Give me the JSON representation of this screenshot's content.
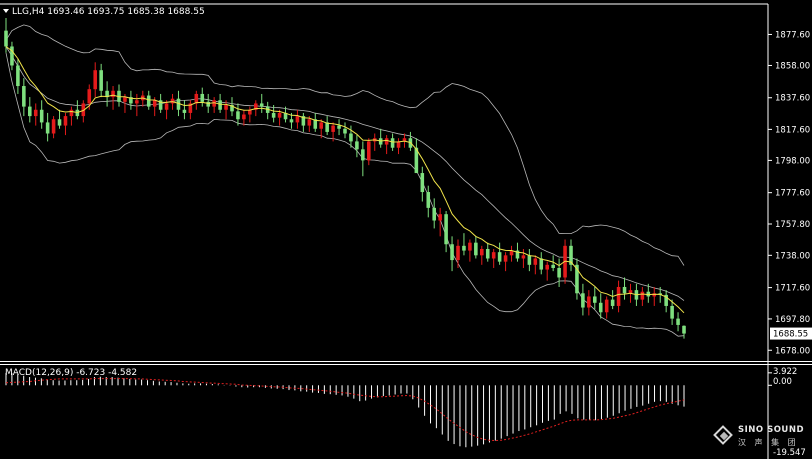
{
  "header": {
    "symbol_line": "LLG,H4  1693.46 1693.75 1685.38 1688.55",
    "menu_icon": "triangle-down-icon"
  },
  "macd": {
    "label": "MACD(12,26,9) -6.723 -4.582",
    "tick_top": "3.922",
    "tick_zero": "0.00",
    "tick_bottom": "-19.547"
  },
  "logo": {
    "name": "SINO SOUND",
    "sub": "汉 声 集 团",
    "icon": "diamond-logo-icon"
  },
  "colors": {
    "background": "#000000",
    "bull": "#e41b1b",
    "bear": "#7fe07f",
    "bands": "#b8b8b8",
    "ma": "#f0e34a",
    "macd_hist": "#ffffff",
    "macd_signal": "#e02020",
    "price_label_bg": "#ffffff",
    "price_label_fg": "#000000"
  },
  "chart_data": {
    "type": "candlestick",
    "ylim": [
      1675.0,
      1888.0
    ],
    "yticks": [
      "1877.60",
      "1858.00",
      "1837.60",
      "1817.60",
      "1798.00",
      "1777.60",
      "1757.80",
      "1738.00",
      "1717.60",
      "1697.80",
      "1678.00"
    ],
    "last_price": "1688.55",
    "candles": [
      [
        1880,
        1888,
        1866,
        1870
      ],
      [
        1870,
        1873,
        1855,
        1858
      ],
      [
        1858,
        1862,
        1840,
        1845
      ],
      [
        1845,
        1850,
        1826,
        1832
      ],
      [
        1832,
        1838,
        1822,
        1826
      ],
      [
        1826,
        1834,
        1820,
        1830
      ],
      [
        1830,
        1836,
        1818,
        1822
      ],
      [
        1822,
        1828,
        1810,
        1815
      ],
      [
        1815,
        1826,
        1812,
        1824
      ],
      [
        1824,
        1830,
        1818,
        1820
      ],
      [
        1820,
        1828,
        1814,
        1826
      ],
      [
        1826,
        1832,
        1820,
        1830
      ],
      [
        1830,
        1836,
        1824,
        1826
      ],
      [
        1826,
        1836,
        1822,
        1834
      ],
      [
        1834,
        1846,
        1830,
        1843
      ],
      [
        1843,
        1860,
        1838,
        1855
      ],
      [
        1855,
        1859,
        1838,
        1842
      ],
      [
        1842,
        1848,
        1832,
        1838
      ],
      [
        1838,
        1845,
        1830,
        1842
      ],
      [
        1842,
        1846,
        1832,
        1835
      ],
      [
        1835,
        1840,
        1828,
        1838
      ],
      [
        1838,
        1842,
        1830,
        1834
      ],
      [
        1834,
        1840,
        1826,
        1836
      ],
      [
        1836,
        1842,
        1832,
        1839
      ],
      [
        1839,
        1842,
        1830,
        1832
      ],
      [
        1832,
        1838,
        1826,
        1836
      ],
      [
        1836,
        1840,
        1828,
        1830
      ],
      [
        1830,
        1836,
        1824,
        1834
      ],
      [
        1834,
        1840,
        1830,
        1837
      ],
      [
        1837,
        1842,
        1826,
        1830
      ],
      [
        1830,
        1836,
        1824,
        1828
      ],
      [
        1828,
        1836,
        1824,
        1834
      ],
      [
        1834,
        1842,
        1830,
        1840
      ],
      [
        1840,
        1844,
        1832,
        1835
      ],
      [
        1835,
        1840,
        1828,
        1832
      ],
      [
        1832,
        1838,
        1828,
        1836
      ],
      [
        1836,
        1840,
        1828,
        1830
      ],
      [
        1830,
        1836,
        1824,
        1833
      ],
      [
        1833,
        1838,
        1826,
        1829
      ],
      [
        1829,
        1834,
        1820,
        1824
      ],
      [
        1824,
        1830,
        1820,
        1827
      ],
      [
        1827,
        1832,
        1822,
        1830
      ],
      [
        1830,
        1836,
        1826,
        1834
      ],
      [
        1834,
        1840,
        1828,
        1832
      ],
      [
        1832,
        1835,
        1824,
        1828
      ],
      [
        1828,
        1833,
        1822,
        1825
      ],
      [
        1825,
        1830,
        1820,
        1828
      ],
      [
        1828,
        1832,
        1822,
        1824
      ],
      [
        1824,
        1828,
        1818,
        1822
      ],
      [
        1822,
        1830,
        1818,
        1826
      ],
      [
        1826,
        1828,
        1816,
        1820
      ],
      [
        1820,
        1826,
        1816,
        1824
      ],
      [
        1824,
        1828,
        1816,
        1818
      ],
      [
        1818,
        1824,
        1812,
        1822
      ],
      [
        1822,
        1826,
        1814,
        1816
      ],
      [
        1816,
        1822,
        1810,
        1820
      ],
      [
        1820,
        1824,
        1814,
        1818
      ],
      [
        1818,
        1822,
        1812,
        1815
      ],
      [
        1815,
        1820,
        1806,
        1810
      ],
      [
        1810,
        1814,
        1800,
        1805
      ],
      [
        1805,
        1810,
        1788,
        1798
      ],
      [
        1798,
        1812,
        1795,
        1810
      ],
      [
        1810,
        1815,
        1804,
        1812
      ],
      [
        1812,
        1818,
        1806,
        1808
      ],
      [
        1808,
        1814,
        1802,
        1812
      ],
      [
        1812,
        1815,
        1804,
        1806
      ],
      [
        1806,
        1812,
        1802,
        1810
      ],
      [
        1810,
        1815,
        1806,
        1812
      ],
      [
        1812,
        1816,
        1804,
        1806
      ],
      [
        1806,
        1812,
        1800,
        1790
      ],
      [
        1790,
        1794,
        1772,
        1778
      ],
      [
        1778,
        1782,
        1762,
        1768
      ],
      [
        1768,
        1774,
        1755,
        1760
      ],
      [
        1760,
        1768,
        1750,
        1764
      ],
      [
        1764,
        1766,
        1740,
        1745
      ],
      [
        1745,
        1750,
        1728,
        1735
      ],
      [
        1735,
        1748,
        1730,
        1744
      ],
      [
        1744,
        1752,
        1738,
        1741
      ],
      [
        1741,
        1748,
        1734,
        1746
      ],
      [
        1746,
        1750,
        1736,
        1738
      ],
      [
        1738,
        1744,
        1732,
        1742
      ],
      [
        1742,
        1746,
        1734,
        1736
      ],
      [
        1736,
        1742,
        1730,
        1740
      ],
      [
        1740,
        1746,
        1732,
        1734
      ],
      [
        1734,
        1740,
        1728,
        1738
      ],
      [
        1738,
        1744,
        1734,
        1741
      ],
      [
        1741,
        1746,
        1734,
        1736
      ],
      [
        1736,
        1742,
        1730,
        1738
      ],
      [
        1738,
        1742,
        1728,
        1732
      ],
      [
        1732,
        1738,
        1726,
        1736
      ],
      [
        1736,
        1740,
        1726,
        1729
      ],
      [
        1729,
        1734,
        1722,
        1732
      ],
      [
        1732,
        1738,
        1728,
        1730
      ],
      [
        1730,
        1736,
        1718,
        1724
      ],
      [
        1724,
        1748,
        1720,
        1744
      ],
      [
        1744,
        1748,
        1728,
        1732
      ],
      [
        1732,
        1736,
        1710,
        1714
      ],
      [
        1714,
        1720,
        1700,
        1705
      ],
      [
        1705,
        1716,
        1700,
        1712
      ],
      [
        1712,
        1718,
        1704,
        1708
      ],
      [
        1708,
        1714,
        1698,
        1702
      ],
      [
        1702,
        1712,
        1698,
        1710
      ],
      [
        1710,
        1716,
        1704,
        1706
      ],
      [
        1706,
        1722,
        1702,
        1718
      ],
      [
        1718,
        1724,
        1710,
        1714
      ],
      [
        1714,
        1720,
        1708,
        1716
      ],
      [
        1716,
        1720,
        1706,
        1710
      ],
      [
        1710,
        1718,
        1706,
        1715
      ],
      [
        1715,
        1720,
        1708,
        1712
      ],
      [
        1712,
        1718,
        1706,
        1714
      ],
      [
        1714,
        1718,
        1708,
        1713
      ],
      [
        1713,
        1716,
        1702,
        1706
      ],
      [
        1706,
        1710,
        1694,
        1698
      ],
      [
        1698,
        1702,
        1690,
        1694
      ],
      [
        1693.46,
        1693.75,
        1685.38,
        1688.55
      ]
    ],
    "macd_ylim": [
      -21.0,
      4.5
    ],
    "macd_hist": [
      3.9,
      3.8,
      3.5,
      3.0,
      2.6,
      2.4,
      2.2,
      1.8,
      1.6,
      1.5,
      1.5,
      1.6,
      1.6,
      1.7,
      2.0,
      2.6,
      2.7,
      2.6,
      2.6,
      2.4,
      2.2,
      2.0,
      1.8,
      1.8,
      1.6,
      1.4,
      1.2,
      1.1,
      1.0,
      0.8,
      0.6,
      0.5,
      0.6,
      0.6,
      0.5,
      0.4,
      0.3,
      0.1,
      -0.1,
      -0.4,
      -0.6,
      -0.7,
      -0.6,
      -0.6,
      -0.8,
      -1.0,
      -1.1,
      -1.2,
      -1.5,
      -1.6,
      -1.9,
      -2.0,
      -2.3,
      -2.4,
      -2.7,
      -2.8,
      -3.0,
      -3.2,
      -3.6,
      -4.2,
      -5.0,
      -4.8,
      -4.2,
      -3.8,
      -3.4,
      -3.2,
      -2.9,
      -2.6,
      -2.6,
      -4.4,
      -7.0,
      -9.6,
      -12.0,
      -13.5,
      -15.5,
      -17.5,
      -18.5,
      -19.2,
      -19.5,
      -19.3,
      -19.0,
      -18.6,
      -18.0,
      -17.4,
      -16.8,
      -16.0,
      -15.2,
      -14.4,
      -13.9,
      -13.2,
      -12.6,
      -11.8,
      -11.2,
      -10.8,
      -9.0,
      -8.2,
      -9.0,
      -10.4,
      -10.8,
      -10.9,
      -11.0,
      -10.6,
      -10.2,
      -9.6,
      -8.8,
      -8.0,
      -7.4,
      -6.8,
      -6.4,
      -5.8,
      -5.2,
      -5.0,
      -5.2,
      -5.8,
      -6.3,
      -6.7
    ],
    "macd_signal": [
      0.8,
      0.9,
      1.0,
      1.1,
      1.2,
      1.4,
      1.6,
      1.8,
      1.9,
      2.0,
      2.0,
      2.0,
      2.0,
      2.0,
      2.0,
      2.1,
      2.1,
      2.1,
      2.1,
      2.1,
      2.1,
      2.1,
      2.0,
      2.0,
      1.9,
      1.8,
      1.7,
      1.6,
      1.5,
      1.4,
      1.2,
      1.1,
      1.0,
      0.9,
      0.8,
      0.7,
      0.6,
      0.5,
      0.4,
      0.3,
      0.1,
      0.0,
      -0.1,
      -0.2,
      -0.3,
      -0.4,
      -0.5,
      -0.6,
      -0.8,
      -0.9,
      -1.0,
      -1.2,
      -1.4,
      -1.5,
      -1.7,
      -1.9,
      -2.1,
      -2.3,
      -2.5,
      -2.8,
      -3.1,
      -3.3,
      -3.5,
      -3.6,
      -3.6,
      -3.5,
      -3.4,
      -3.3,
      -3.2,
      -3.4,
      -4.0,
      -5.0,
      -6.2,
      -7.5,
      -9.0,
      -10.6,
      -12.0,
      -13.3,
      -14.6,
      -15.6,
      -16.4,
      -17.0,
      -17.3,
      -17.4,
      -17.3,
      -17.0,
      -16.6,
      -16.2,
      -15.7,
      -15.2,
      -14.6,
      -14.0,
      -13.4,
      -12.8,
      -12.1,
      -11.4,
      -11.0,
      -10.9,
      -10.9,
      -10.9,
      -10.9,
      -10.8,
      -10.6,
      -10.4,
      -10.0,
      -9.6,
      -9.2,
      -8.6,
      -8.0,
      -7.4,
      -6.8,
      -6.2,
      -5.8,
      -5.4,
      -5.0,
      -4.6
    ]
  }
}
